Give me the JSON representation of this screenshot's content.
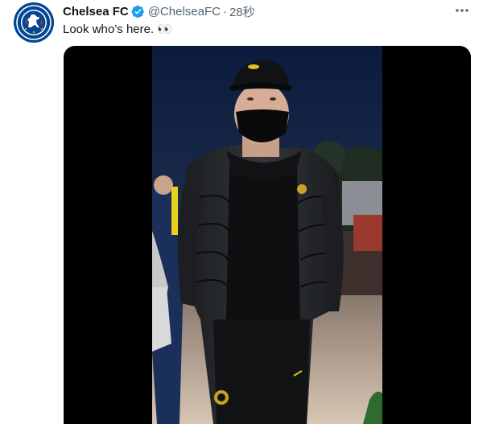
{
  "tweet": {
    "display_name": "Chelsea FC",
    "handle": "@ChelseaFC",
    "separator": "·",
    "time": "28秒",
    "text": "Look who’s here. 👀",
    "verified_icon": "verified-badge-icon",
    "more_icon": "more-horizontal-icon",
    "avatar": "chelsea-crest-logo",
    "media": "video-frame"
  },
  "colors": {
    "name": "#0f1419",
    "secondary": "#536471",
    "verified": "#1d9bf0",
    "chelsea_blue": "#034694",
    "media_bg": "#000000"
  }
}
